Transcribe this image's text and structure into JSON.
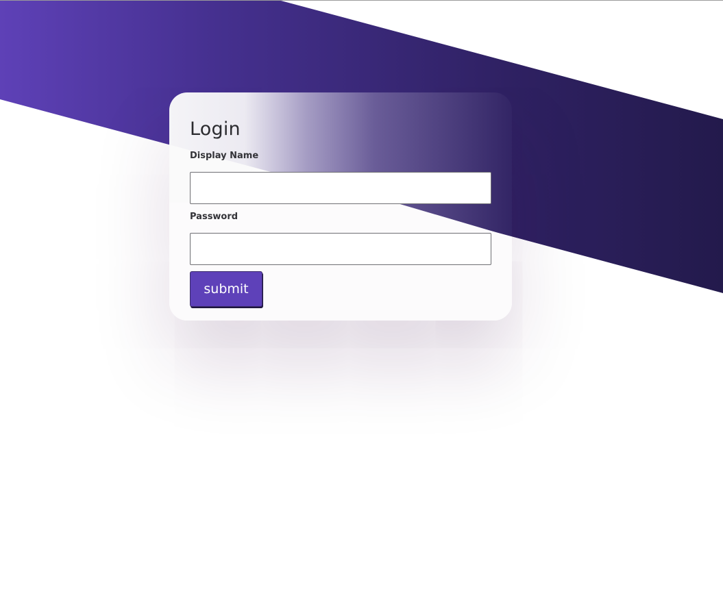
{
  "login": {
    "title": "Login",
    "display_name_label": "Display Name",
    "display_name_value": "",
    "password_label": "Password",
    "password_value": "",
    "submit_label": "submit"
  },
  "colors": {
    "accent": "#5e41b9",
    "band_start": "#5e41b7",
    "band_end": "#231a4c",
    "text": "#2b2b2f"
  }
}
